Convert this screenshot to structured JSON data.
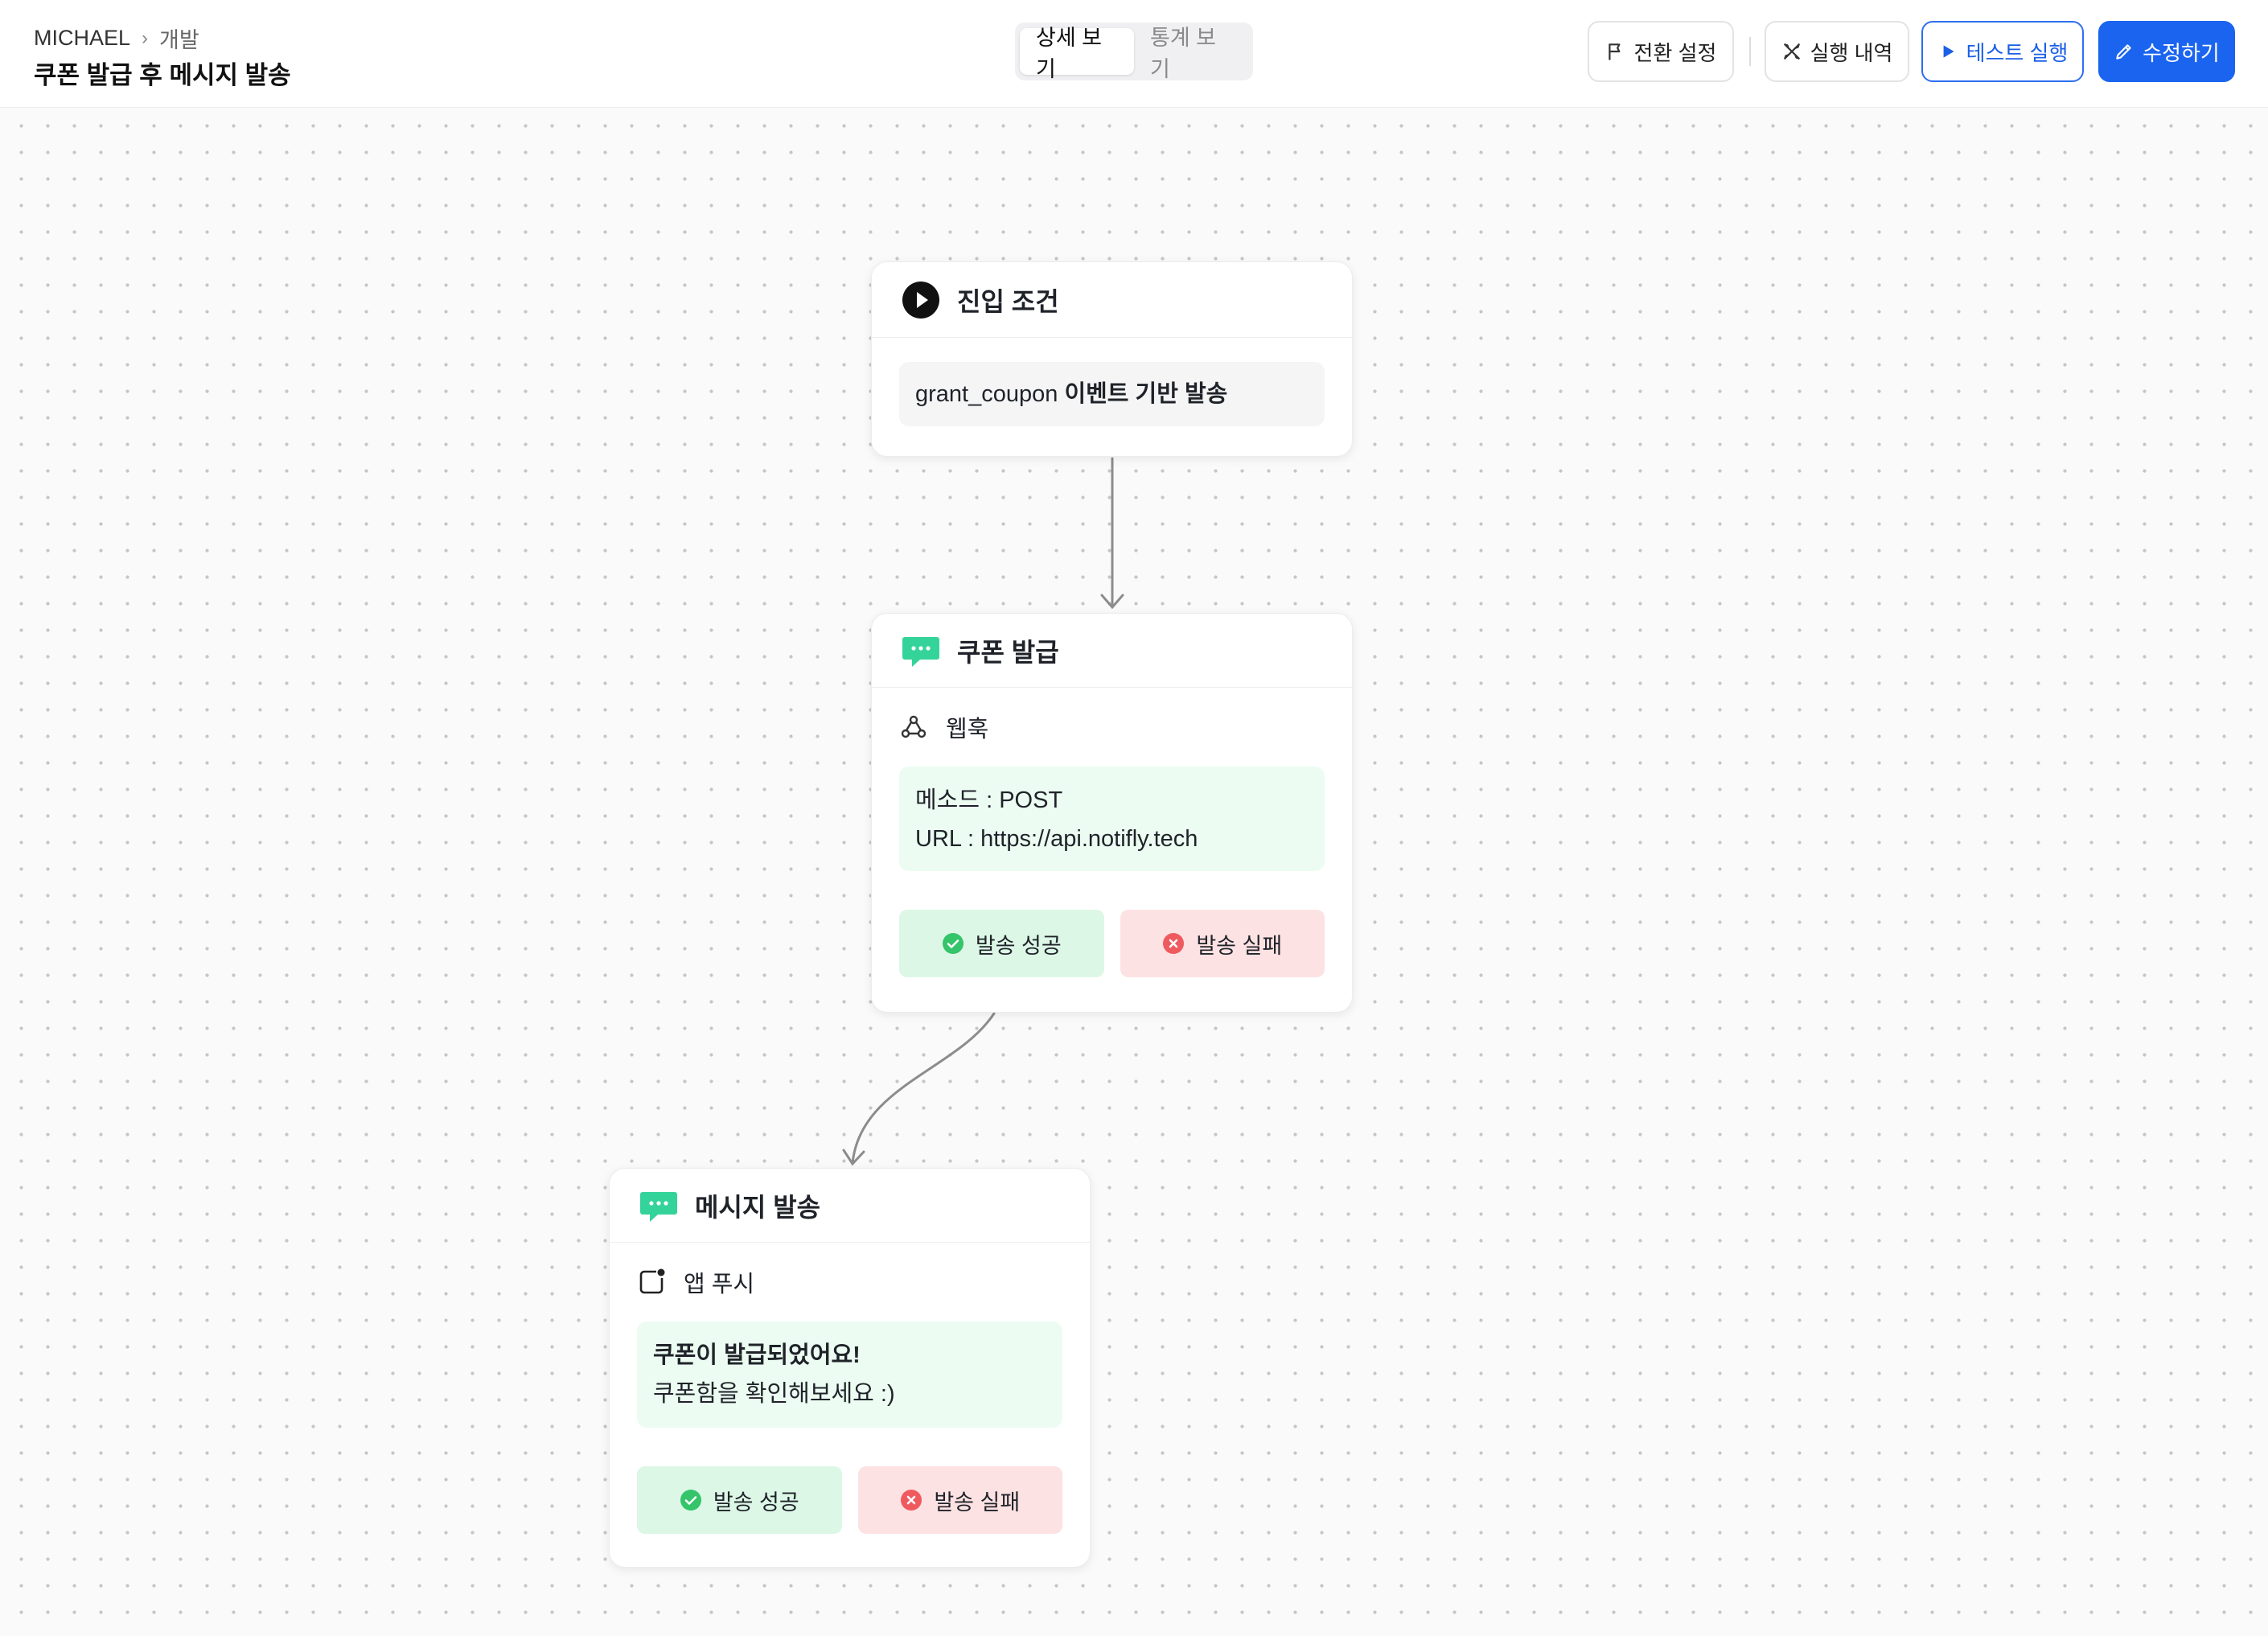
{
  "header": {
    "breadcrumb": [
      "MICHAEL",
      "개발"
    ],
    "title": "쿠폰 발급 후 메시지 발송",
    "view_tabs": [
      {
        "label": "상세 보기",
        "active": true
      },
      {
        "label": "통계 보기",
        "active": false
      }
    ],
    "actions": {
      "transition_settings": "전환 설정",
      "run_history": "실행 내역",
      "test_run": "테스트 실행",
      "edit": "수정하기"
    }
  },
  "nodes": {
    "entry": {
      "title": "진입 조건",
      "event_name": "grant_coupon",
      "condition_text": "이벤트 기반 발송"
    },
    "coupon": {
      "title": "쿠폰 발급",
      "channel": "웹훅",
      "method_line": "메소드 : POST",
      "url_line": "URL : https://api.notifly.tech",
      "success_label": "발송 성공",
      "fail_label": "발송 실패"
    },
    "message": {
      "title": "메시지 발송",
      "channel": "앱 푸시",
      "push_title": "쿠폰이 발급되었어요!",
      "push_body": "쿠폰함을 확인해보세요 :)",
      "success_label": "발송 성공",
      "fail_label": "발송 실패"
    }
  },
  "colors": {
    "primary": "#1a64f0",
    "message_icon": "#34d39a",
    "success_bg": "#dcf7e6",
    "fail_bg": "#fde2e3",
    "success_icon": "#34c46a",
    "fail_icon": "#ef5a5f"
  }
}
